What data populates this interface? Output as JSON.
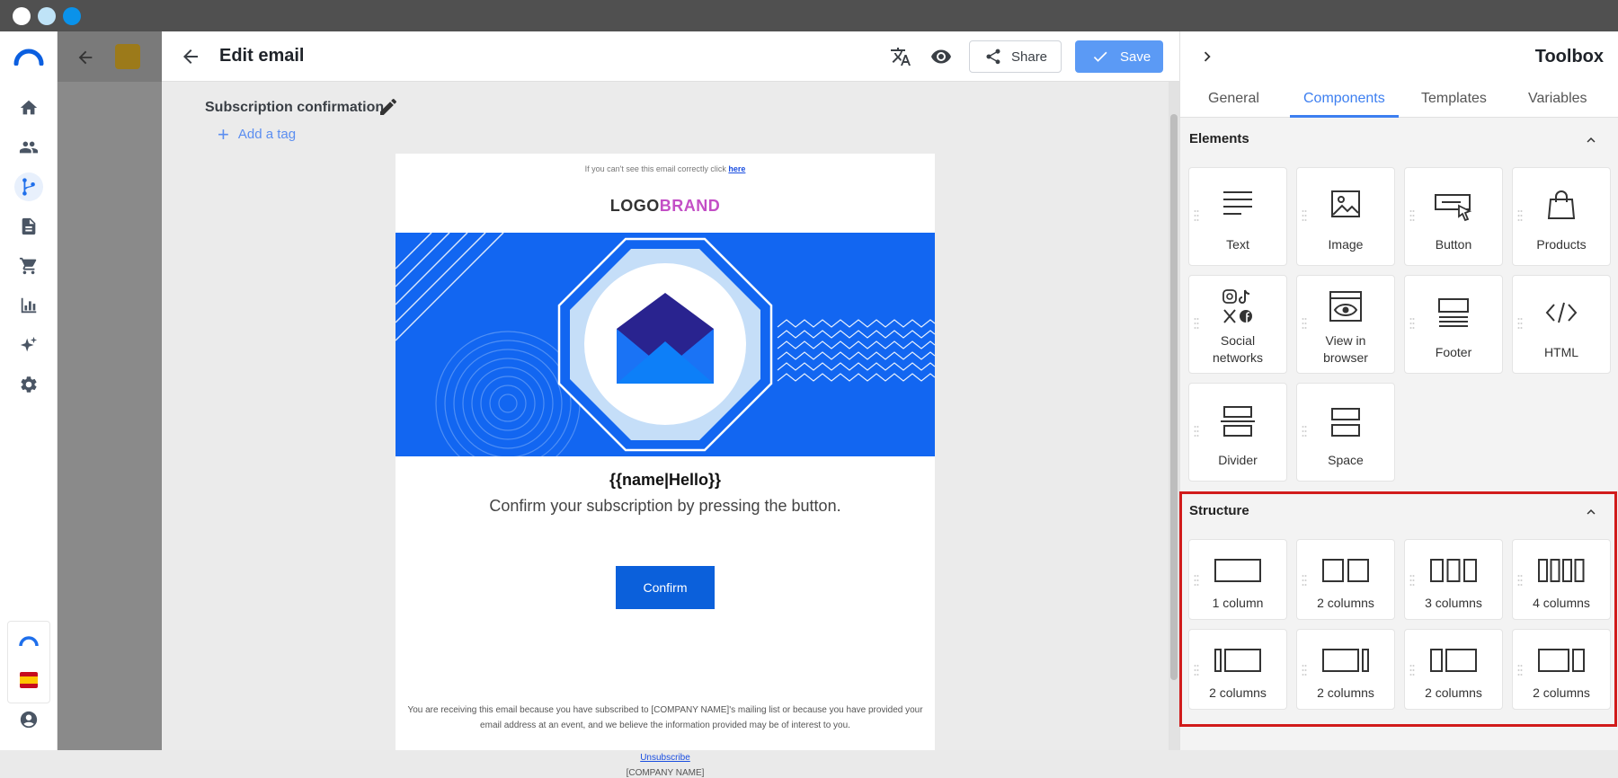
{
  "window": {
    "dots": [
      "#ffffff",
      "#bfe3f7",
      "#0a92ea"
    ]
  },
  "nav": {
    "items": [
      "home-icon",
      "people-icon",
      "flow-icon",
      "document-icon",
      "cart-icon",
      "bar-chart-icon",
      "sparkle-icon",
      "gear-icon"
    ],
    "active": "flow-icon"
  },
  "editor": {
    "title": "Edit email",
    "share_label": "Share",
    "save_label": "Save",
    "subject": "Subscription confirmation",
    "add_tag_label": "Add a tag"
  },
  "email": {
    "preheader_text": "If you can't see this email correctly click",
    "preheader_link": "here",
    "logo_part1": "LOGO",
    "logo_part2": "BRAND",
    "headline": "{{name|Hello}}",
    "subline": "Confirm your subscription by pressing the button.",
    "button_label": "Confirm",
    "footer_text": "You are receiving this email because you have subscribed to [COMPANY NAME]'s mailing list or because you have provided your email address at an event, and we believe the information provided may be of interest to you.",
    "unsubscribe": "Unsubscribe",
    "company": "[COMPANY NAME]"
  },
  "toolbox": {
    "title": "Toolbox",
    "tabs": [
      "General",
      "Components",
      "Templates",
      "Variables"
    ],
    "active_tab": "Components",
    "elements_title": "Elements",
    "elements": [
      "Text",
      "Image",
      "Button",
      "Products",
      "Social networks",
      "View in browser",
      "Footer",
      "HTML",
      "Divider",
      "Space"
    ],
    "structure_title": "Structure",
    "structure": [
      "1 column",
      "2 columns",
      "3 columns",
      "4 columns",
      "2 columns",
      "2 columns",
      "2 columns",
      "2 columns"
    ]
  },
  "colors": {
    "accent": "#3d7ff0",
    "save_button": "#5b9af5",
    "hero_blue": "#1266f1",
    "confirm_button": "#0b60db",
    "highlight": "#d11b1b",
    "logo_brand": "#c34fc6"
  }
}
